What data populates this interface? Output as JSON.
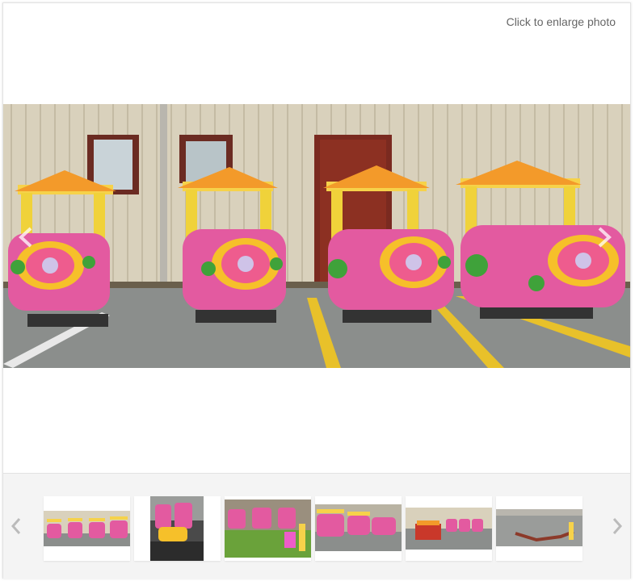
{
  "viewer": {
    "enlarge_label": "Click to enlarge photo"
  },
  "icons": {
    "prev": "chevron-left-icon",
    "next": "chevron-right-icon"
  },
  "colors": {
    "frame_border": "#e2e2e2",
    "strip_background": "#f4f4f4",
    "arrow": "#bbbbbb"
  },
  "thumbnails": [
    {
      "name": "thumbnail-1"
    },
    {
      "name": "thumbnail-2"
    },
    {
      "name": "thumbnail-3"
    },
    {
      "name": "thumbnail-4"
    },
    {
      "name": "thumbnail-5"
    },
    {
      "name": "thumbnail-6"
    }
  ]
}
